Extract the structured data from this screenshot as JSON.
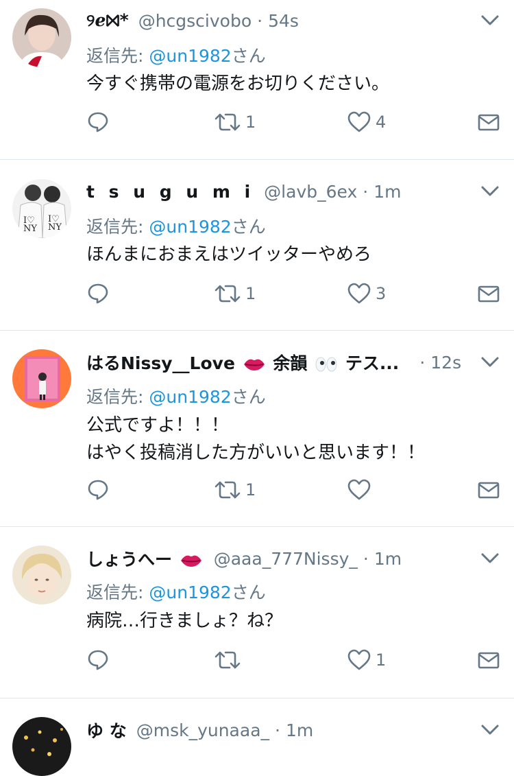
{
  "tweets": [
    {
      "name": "୨ℯ⨝*",
      "handle": "@hcgscivobo",
      "sep": "·",
      "time": "54s",
      "reply_prefix": "返信先:",
      "reply_to": "@un1982",
      "reply_suffix": "さん",
      "text_lines": [
        "今すぐ携帯の電源をお切りください。"
      ],
      "retweets": "1",
      "likes": "4"
    },
    {
      "name": "t s u g u m i",
      "handle": "@lavb_6ex",
      "sep": "·",
      "time": "1m",
      "reply_prefix": "返信先:",
      "reply_to": "@un1982",
      "reply_suffix": "さん",
      "text_lines": [
        "ほんまにおまえはツイッターやめろ"
      ],
      "retweets": "1",
      "likes": "3"
    },
    {
      "name_part1": "はるNissy__Love",
      "name_part2": "余韻",
      "name_part3": " テス...",
      "sep": "·",
      "time": "12s",
      "reply_prefix": "返信先:",
      "reply_to": "@un1982",
      "reply_suffix": "さん",
      "text_lines": [
        "公式ですよ！！！",
        "はやく投稿消した方がいいと思います！！"
      ],
      "retweets": "1",
      "likes": ""
    },
    {
      "name": "しょうへー",
      "handle": "@aaa_777Nissy_",
      "sep": "·",
      "time": "1m",
      "reply_prefix": "返信先:",
      "reply_to": "@un1982",
      "reply_suffix": "さん",
      "text_lines": [
        "病院…行きましょ？ね？"
      ],
      "retweets": "",
      "likes": "1"
    },
    {
      "name": "ゆ な",
      "handle": "@msk_yunaaa_",
      "sep": "·",
      "time": "1m"
    }
  ],
  "icons": {
    "reply": "reply-icon",
    "retweet": "retweet-icon",
    "like": "heart-icon",
    "dm": "mail-icon",
    "caret": "chevron-down-icon"
  },
  "colors": {
    "text": "#14171a",
    "secondary": "#657786",
    "link": "#1b95e0",
    "divider": "#e1e8ed"
  }
}
